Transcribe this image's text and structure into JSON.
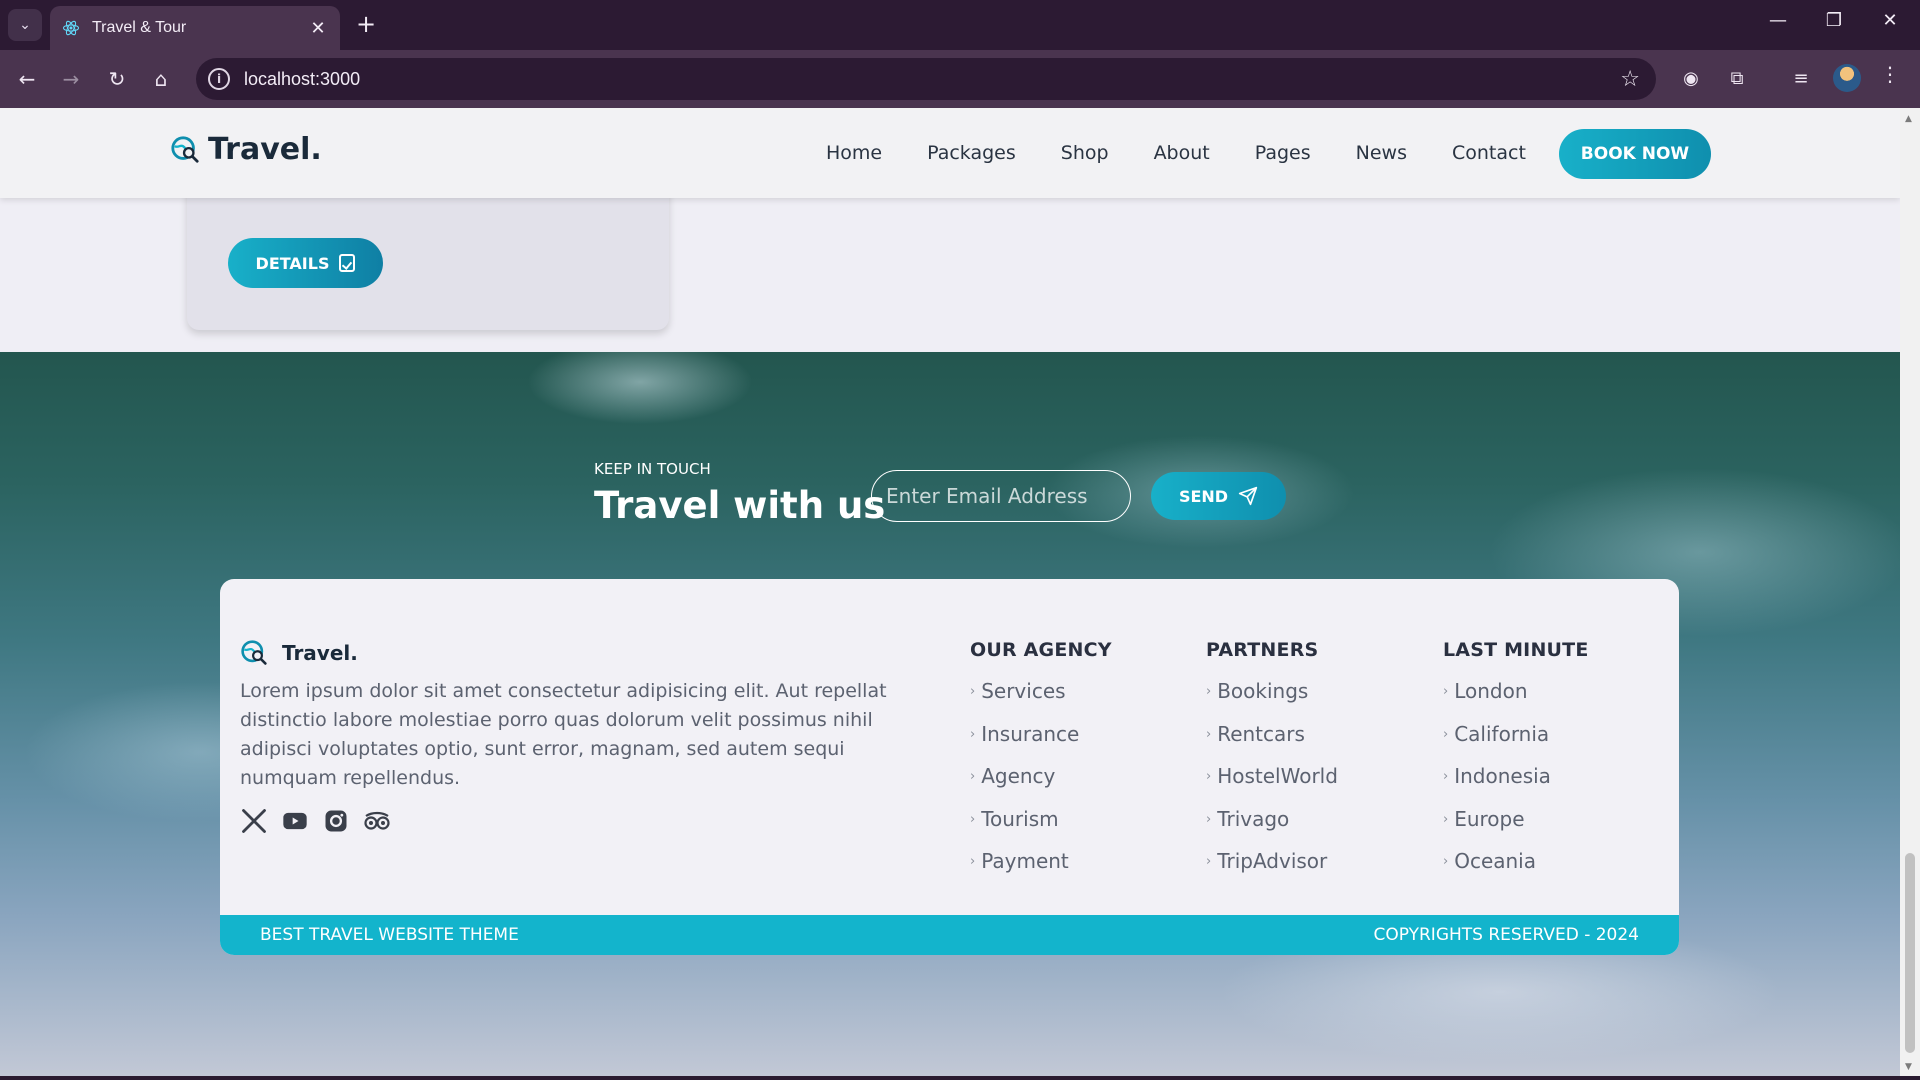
{
  "browser": {
    "tab_title": "Travel & Tour",
    "url": "localhost:3000"
  },
  "header": {
    "logo": "Travel.",
    "nav": [
      "Home",
      "Packages",
      "Shop",
      "About",
      "Pages",
      "News",
      "Contact"
    ],
    "book_now": "BOOK NOW"
  },
  "card": {
    "details_label": "DETAILS"
  },
  "newsletter": {
    "eyebrow": "KEEP IN TOUCH",
    "title": "Travel with us",
    "email_placeholder": "Enter Email Address",
    "send_label": "SEND"
  },
  "footer": {
    "logo": "Travel.",
    "description": "Lorem ipsum dolor sit amet consectetur adipisicing elit. Aut repellat distinctio labore molestiae porro quas dolorum velit possimus nihil adipisci voluptates optio, sunt error, magnam, sed autem sequi numquam repellendus.",
    "socials": [
      "x-icon",
      "youtube-icon",
      "instagram-icon",
      "tripadvisor-icon"
    ],
    "columns": [
      {
        "title": "OUR AGENCY",
        "items": [
          "Services",
          "Insurance",
          "Agency",
          "Tourism",
          "Payment"
        ]
      },
      {
        "title": "PARTNERS",
        "items": [
          "Bookings",
          "Rentcars",
          "HostelWorld",
          "Trivago",
          "TripAdvisor"
        ]
      },
      {
        "title": "LAST MINUTE",
        "items": [
          "London",
          "California",
          "Indonesia",
          "Europe",
          "Oceania"
        ]
      }
    ],
    "bar_left": "BEST TRAVEL WEBSITE THEME",
    "bar_right": "COPYRIGHTS RESERVED - 2024"
  },
  "colors": {
    "accent": "#13b4cc",
    "accent_dark": "#0f8fae",
    "text_dark": "#1a2a3a"
  }
}
